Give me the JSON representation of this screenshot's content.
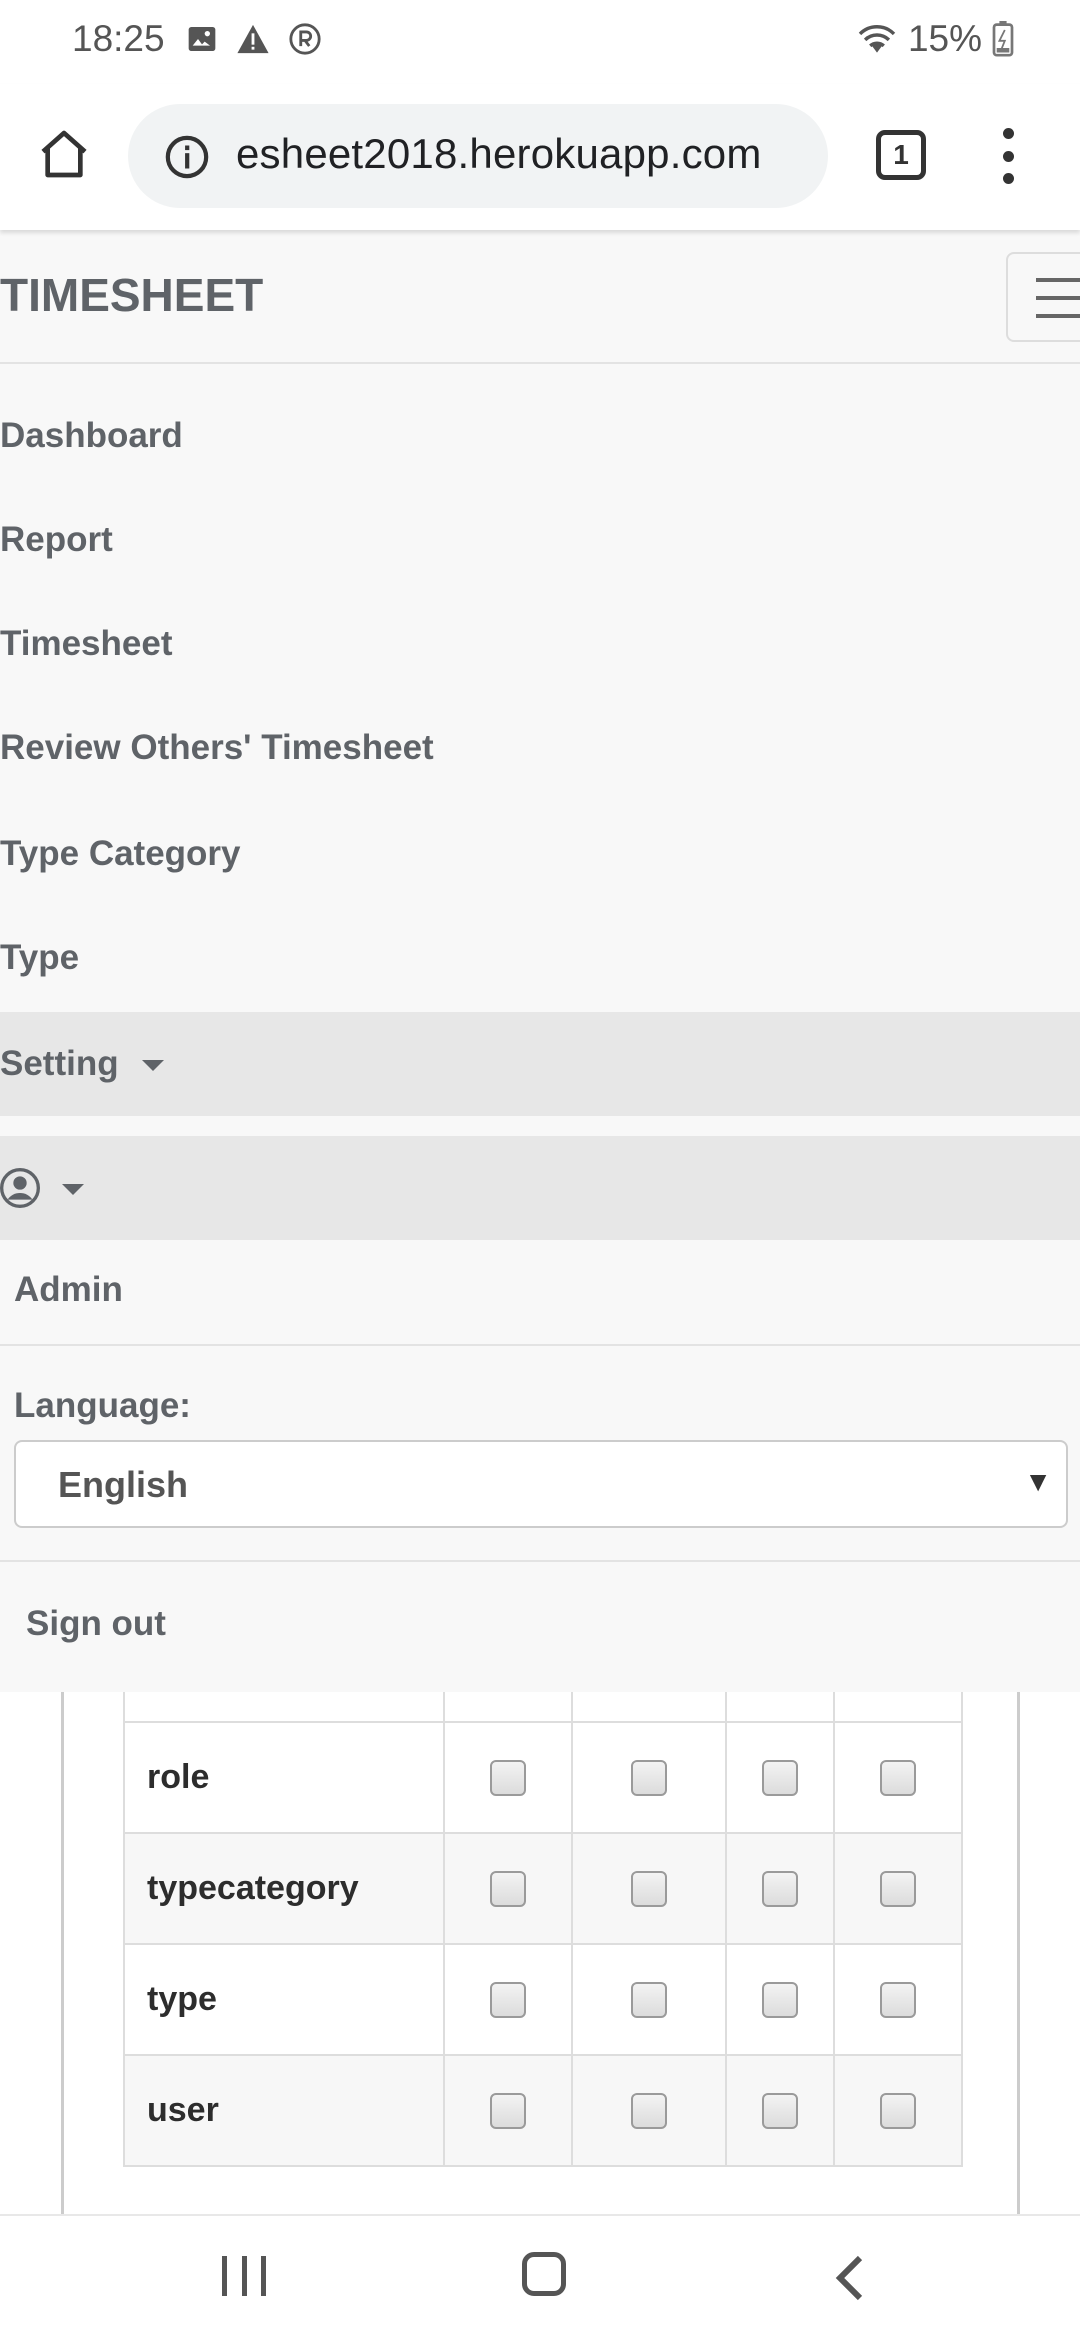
{
  "status_bar": {
    "time": "18:25",
    "battery": "15%",
    "icons": [
      "image-icon",
      "warning-icon",
      "registered-icon",
      "wifi-icon",
      "battery-icon"
    ]
  },
  "browser": {
    "url": "esheet2018.herokuapp.com",
    "tab_count": "1"
  },
  "navbar": {
    "brand": "TIMESHEET",
    "items": [
      {
        "label": "Dashboard"
      },
      {
        "label": "Report"
      },
      {
        "label": "Timesheet"
      },
      {
        "label": "Review Others' Timesheet"
      },
      {
        "label": "Type Category"
      },
      {
        "label": "Type"
      }
    ],
    "setting_label": "Setting",
    "user_menu": {
      "username": "Admin",
      "language_label": "Language:",
      "language_value": "English",
      "sign_out": "Sign out"
    }
  },
  "permissions_table": {
    "rows": [
      {
        "name": "role"
      },
      {
        "name": "typecategory"
      },
      {
        "name": "type"
      },
      {
        "name": "user"
      }
    ]
  },
  "colors": {
    "navbar_bg": "#f8f8f8",
    "active_bg": "#e7e7e7",
    "nav_text": "#5f6368",
    "url_pill": "#f1f3f4"
  }
}
